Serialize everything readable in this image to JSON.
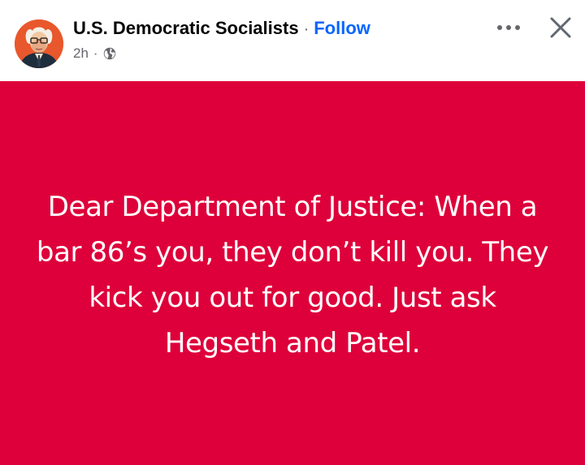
{
  "header": {
    "page_name": "U.S. Democratic Socialists",
    "separator": "·",
    "follow_label": "Follow",
    "timestamp": "2h",
    "meta_separator": "·",
    "audience_icon": "globe-icon",
    "more_icon": "more-options-icon",
    "close_icon": "close-icon",
    "avatar_icon": "profile-portrait"
  },
  "post": {
    "background_color": "#de003a",
    "text_color": "#ffffff",
    "text": "Dear Department of Justice: When a bar 86’s you, they don’t kill you. They kick you out for good. Just ask Hegseth and Patel."
  },
  "colors": {
    "link": "#0866ff",
    "secondary_text": "#65676b",
    "primary_text": "#050505"
  }
}
